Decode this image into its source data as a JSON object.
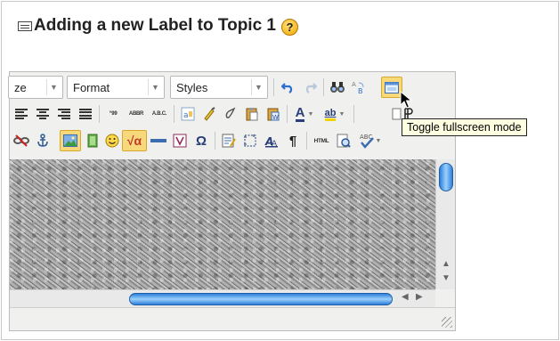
{
  "page": {
    "heading": "Adding a new Label to Topic 1",
    "help_symbol": "?"
  },
  "editor": {
    "toolbar_row1": {
      "fontsize_partial": "ze",
      "format_label": "Format",
      "styles_label": "Styles",
      "buttons": [
        "undo-icon",
        "redo-icon",
        "find-icon",
        "replace-icon",
        "fullscreen-icon"
      ]
    },
    "toolbar_row2": {
      "buttons": [
        "align-left-icon",
        "align-center-icon",
        "align-right-icon",
        "align-justify-icon",
        "blockquote-icon",
        "abbreviation-icon",
        "acronym-icon",
        "paste-text-icon",
        "cleanup-icon",
        "remove-format-icon",
        "paste-icon",
        "paste-word-icon",
        "text-color-icon",
        "background-color-icon",
        "absolute-position-icon",
        "rtl-icon"
      ],
      "quote_text": "“99",
      "abbr_text": "ABBR",
      "acronym_text": "A.B.C.",
      "text_color_glyph": "A",
      "bg_color_glyph": "ab"
    },
    "toolbar_row3": {
      "buttons": [
        "unlink-icon",
        "anchor-icon",
        "image-icon",
        "moodle-media-icon",
        "emoticon-icon",
        "equation-icon",
        "horizontal-rule-icon",
        "nonbreaking-icon",
        "special-char-icon",
        "template-icon",
        "visual-aid-icon",
        "styleprops-icon",
        "show-blocks-icon",
        "html-source-icon",
        "preview-icon",
        "spellcheck-icon"
      ],
      "omega": "Ω",
      "pilcrow": "¶",
      "html_text": "HTML",
      "sqrt_text": "√α"
    },
    "tooltip": "Toggle fullscreen mode"
  },
  "colors": {
    "active_button_bg": "#f7d97c",
    "scroll_thumb": "#2e7fd8",
    "tooltip_bg": "#ffffe1",
    "help_icon": "#f3a500"
  }
}
